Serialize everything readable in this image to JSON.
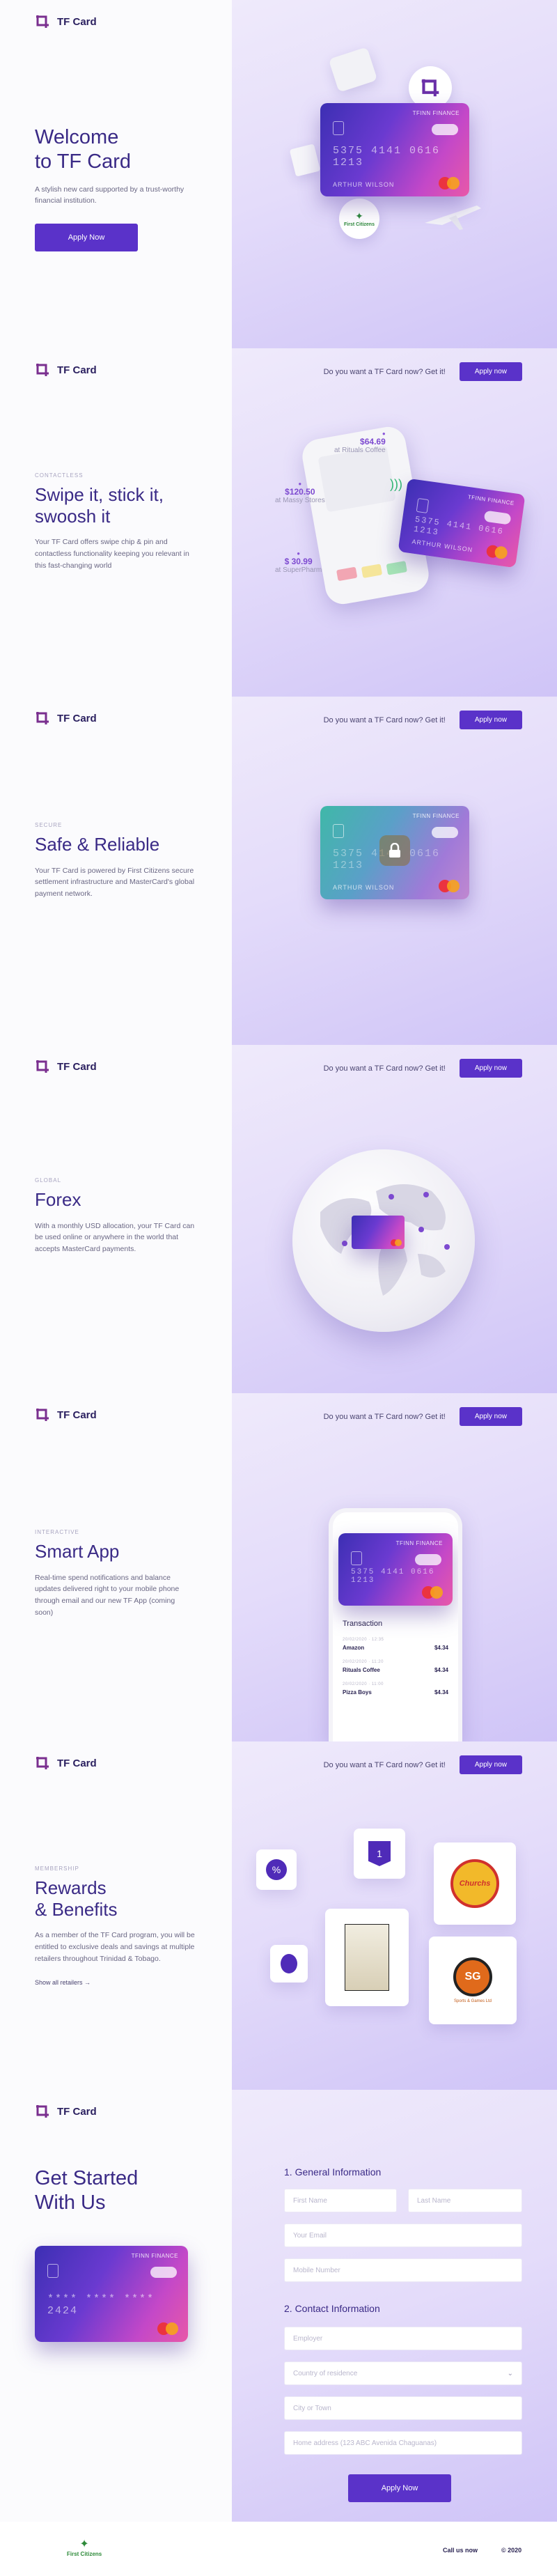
{
  "brand": {
    "name": "TF Card",
    "card_brand": "TFINN FINANCE",
    "accent": "#5a32c9"
  },
  "topbar": {
    "question": "Do you want a TF Card now? Get it!",
    "cta": "Apply now"
  },
  "card": {
    "number": "5375 4141 0616 1213",
    "holder": "ARTHUR WILSON",
    "number_short": "**** **** **** 2424"
  },
  "hero": {
    "title_line1": "Welcome",
    "title_line2": "to TF Card",
    "subtitle": "A stylish new card supported by a trust-worthy financial institution.",
    "button": "Apply Now",
    "badge": "First Citizens"
  },
  "swipe": {
    "eyebrow": "CONTACTLESS",
    "title_line1": "Swipe it, stick it,",
    "title_line2": "swoosh it",
    "body": "Your TF Card offers swipe chip & pin and contactless functionality keeping you relevant in this fast-changing world",
    "callouts": [
      {
        "amount": "$64.69",
        "place": "at Rituals Coffee"
      },
      {
        "amount": "$120.50",
        "place": "at Massy Stores"
      },
      {
        "amount": "$ 30.99",
        "place": "at SuperPharm"
      }
    ]
  },
  "safe": {
    "eyebrow": "SECURE",
    "title": "Safe & Reliable",
    "body": "Your TF Card is powered by First Citizens secure settlement infrastructure and MasterCard's global payment network."
  },
  "forex": {
    "eyebrow": "GLOBAL",
    "title": "Forex",
    "body": "With a monthly USD allocation, your TF Card can be used online or anywhere in the world that accepts MasterCard payments."
  },
  "app": {
    "eyebrow": "INTERACTIVE",
    "title": "Smart App",
    "body": "Real-time spend notifications and balance updates delivered right to your mobile phone through email and our new TF App (coming soon)",
    "transactions_title": "Transaction",
    "transactions": [
      {
        "date": "20/02/2020 · 12:35",
        "merchant": "Amazon",
        "amount": "$4.34"
      },
      {
        "date": "20/02/2020 · 11:20",
        "merchant": "Rituals Coffee",
        "amount": "$4.34"
      },
      {
        "date": "20/02/2020 · 11:00",
        "merchant": "Pizza Boys",
        "amount": "$4.34"
      }
    ]
  },
  "rewards": {
    "eyebrow": "MEMBERSHIP",
    "title_line1": "Rewards",
    "title_line2": "& Benefits",
    "body": "As a member of the TF Card program, you will be entitled to exclusive deals and savings at multiple retailers throughout Trinidad & Tobago.",
    "link": "Show all retailers",
    "badge_number": "1",
    "partner_1": "Churchs",
    "partner_2": "Sports & Games Ltd"
  },
  "getstarted": {
    "title_line1": "Get Started",
    "title_line2": "With Us",
    "section1": "1. General Information",
    "section2": "2. Contact Information",
    "first_name": "First Name",
    "last_name": "Last Name",
    "email": "Your Email",
    "mobile": "Mobile Number",
    "employer": "Employer",
    "country": "Country of residence",
    "city": "City or Town",
    "address": "Home address (123 ABC Avenida Chaguanas)",
    "button": "Apply Now"
  },
  "footer": {
    "brand": "First Citizens",
    "link1": "Call us now",
    "link2": "© 2020"
  }
}
